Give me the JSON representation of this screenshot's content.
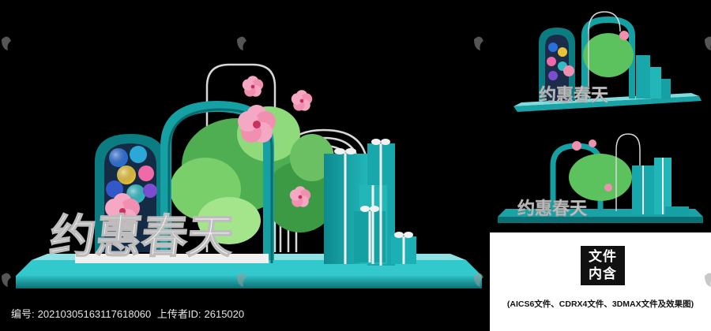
{
  "main_scene": {
    "slogan": "约惠春天"
  },
  "preview_top": {
    "slogan": "约惠春天"
  },
  "preview_mid": {
    "slogan": "约惠春天"
  },
  "info_panel": {
    "badge_line1": "文件",
    "badge_line2": "内含",
    "contents": "(AICS6文件、CDRX4文件、3DMAX文件及效果图)"
  },
  "footer": {
    "id_label": "编号:",
    "id_value": "20210305163117618060",
    "uploader_label": "上传者ID:",
    "uploader_value": "2615020"
  },
  "colors": {
    "teal": "#1aa3a6",
    "teal_dark": "#0c6f73",
    "leaf_green": "#5cc25e",
    "blossom_pink": "#f08fb0",
    "slogan_white": "#f2f2f2"
  },
  "icons": [
    "watermark-icon",
    "blossom-icon",
    "gift-box-icon"
  ]
}
